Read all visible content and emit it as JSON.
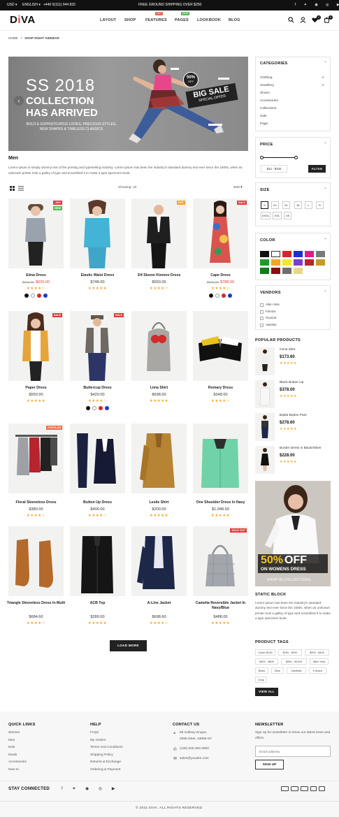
{
  "topbar": {
    "currency": "USD ▾",
    "language": "ENGLISH ▾",
    "phone": "+440 0(111) 044 833",
    "promo": "FREE GROUND SHIPPING OVER $250"
  },
  "header": {
    "logo_main": "D",
    "logo_accent": "i",
    "logo_rest": "VA",
    "nav": [
      "LAYOUT",
      "SHOP",
      "FEATURES",
      "PAGES",
      "LOOKBOOK",
      "BLOG"
    ],
    "badges": {
      "features": "HOT",
      "pages": "NEW"
    },
    "wishlist_count": "0",
    "cart_count": "0"
  },
  "breadcrumb": {
    "home": "HOME",
    "sep": "/",
    "current": "SHOP RIGHT SIDEBAR"
  },
  "banner": {
    "line1": "SS 2018",
    "line2": "COLLECTION",
    "line3": "HAS ARRIVED",
    "sub": "BOLD & SOPHISTICATED LOOKS, PRECIOUS STYLES, NEW SHAPES & TIMELESS CLASSICS",
    "badge_pct": "50%",
    "badge_off": "OFF",
    "sale1": "BIG SALE",
    "sale2": "SPECIAL OFFER"
  },
  "section": {
    "title": "Men",
    "description": "Lorem Ipsum is simply dummy text of the printing and typesetting industry. Lorem Ipsum has been the industry's standard dummy text ever since the 1500s, when an unknown printer took a galley of type and scrambled it to make a type specimen book."
  },
  "toolbar": {
    "showing": "Showing: 22",
    "sort": "Sort ▾"
  },
  "products": [
    {
      "name": "Edna Dress",
      "old": "$500.00",
      "price": "$600.00",
      "sale": true,
      "badges": [
        "-16%",
        "NEW"
      ],
      "badge_colors": [
        "#e03c3c",
        "#5cb85c"
      ],
      "stars": "★★★★☆",
      "swatches": [
        "#111",
        "#fff",
        "#d9232d",
        "#1a3cc2"
      ]
    },
    {
      "name": "Elastic Waist Dress",
      "old": "",
      "price": "$748.00",
      "sale": false,
      "badges": [],
      "badge_colors": [],
      "stars": "★★★★★",
      "swatches": []
    },
    {
      "name": "3/4 Sleeve Kimono Dress",
      "old": "",
      "price": "$550.00",
      "sale": false,
      "badges": [
        "HOT"
      ],
      "badge_colors": [
        "#f5a623"
      ],
      "stars": "★★★★☆",
      "swatches": []
    },
    {
      "name": "Cape Dress",
      "old": "$900.00",
      "price": "$788.00",
      "sale": true,
      "badges": [
        "SALE"
      ],
      "badge_colors": [
        "#e03c3c"
      ],
      "stars": "★★★★☆",
      "swatches": [
        "#111",
        "#fff",
        "#d9232d",
        "#1a3cc2"
      ]
    },
    {
      "name": "Paper Dress",
      "old": "",
      "price": "$550.00",
      "sale": false,
      "badges": [
        "SALE"
      ],
      "badge_colors": [
        "#e03c3c"
      ],
      "stars": "★★★★★",
      "swatches": []
    },
    {
      "name": "Buttercup Dress",
      "old": "",
      "price": "$420.00",
      "sale": false,
      "badges": [
        "SALE"
      ],
      "badge_colors": [
        "#e03c3c"
      ],
      "stars": "★★★★☆",
      "swatches": [
        "#111",
        "#fff",
        "#d9232d",
        "#1a3cc2"
      ]
    },
    {
      "name": "Lima Shirt",
      "old": "",
      "price": "$698.00",
      "sale": false,
      "badges": [],
      "badge_colors": [],
      "stars": "★★★★★",
      "swatches": []
    },
    {
      "name": "Romary Dress",
      "old": "",
      "price": "$348.00",
      "sale": false,
      "badges": [],
      "badge_colors": [],
      "stars": "★★★★☆",
      "swatches": []
    },
    {
      "name": "Floral Sleeveless Dress",
      "old": "",
      "price": "$380.00",
      "sale": false,
      "badges": [
        "POPULAR"
      ],
      "badge_colors": [
        "#f36f48"
      ],
      "stars": "★★★★☆",
      "swatches": []
    },
    {
      "name": "Button Up Dress",
      "old": "",
      "price": "$400.00",
      "sale": false,
      "badges": [],
      "badge_colors": [],
      "stars": "★★★★☆",
      "swatches": []
    },
    {
      "name": "Leslie Shirt",
      "old": "",
      "price": "$200.00",
      "sale": false,
      "badges": [],
      "badge_colors": [],
      "stars": "★★★★★",
      "swatches": []
    },
    {
      "name": "One Shoulder Dress In Navy",
      "old": "",
      "price": "$1,048.60",
      "sale": false,
      "badges": [],
      "badge_colors": [],
      "stars": "★★★★★",
      "swatches": []
    },
    {
      "name": "Triangle Sleeveless Dress In Multi",
      "old": "",
      "price": "$684.60",
      "sale": false,
      "badges": [],
      "badge_colors": [],
      "stars": "★★★★☆",
      "swatches": []
    },
    {
      "name": "ACB Top",
      "old": "",
      "price": "$280.00",
      "sale": false,
      "badges": [],
      "badge_colors": [],
      "stars": "★★★★★",
      "swatches": []
    },
    {
      "name": "A-Line Jacket",
      "old": "",
      "price": "$698.60",
      "sale": false,
      "badges": [],
      "badge_colors": [],
      "stars": "★★★★☆",
      "swatches": []
    },
    {
      "name": "Camelia Reversible Jacket In Navy/Blue",
      "old": "",
      "price": "$488.00",
      "sale": false,
      "badges": [
        "SOLD OUT"
      ],
      "badge_colors": [
        "#e03c3c"
      ],
      "stars": "★★★★★",
      "swatches": []
    }
  ],
  "load_more": "LOAD MORE",
  "sidebar": {
    "categories": {
      "title": "CATEGORIES",
      "items": [
        "Clothing",
        "Jewellery",
        "Shoes",
        "Accessories",
        "Collections",
        "Sale",
        "Page"
      ]
    },
    "price": {
      "title": "PRICE",
      "range": "$12 - $100",
      "button": "FILTER"
    },
    "size": {
      "title": "SIZE",
      "items": [
        "X",
        "XL",
        "XL",
        "M",
        "L",
        "S",
        "XXXL",
        "XXL",
        "XS"
      ]
    },
    "color": {
      "title": "COLOR",
      "colors": [
        "#111111",
        "#ffffff",
        "#d9232d",
        "#1a2fd6",
        "#e5198a",
        "#7a7a7a",
        "#1f9a2a",
        "#f5a623",
        "#f2e92c",
        "#7b3fc6",
        "#b8262a",
        "#c49b2a",
        "#137a1e",
        "#8a1010",
        "#6e6e6e",
        "#e6d886"
      ]
    },
    "vendors": {
      "title": "VENDORS",
      "items": [
        "Allen Vela",
        "Famiza",
        "Oxymat",
        "Vanelas"
      ]
    },
    "popular": {
      "title": "POPULAR PRODUCTS",
      "items": [
        {
          "name": "Cena Skirt",
          "price": "$173.60",
          "stars": "★★★★★"
        },
        {
          "name": "Black Button Up",
          "price": "$378.00",
          "stars": "★★★★★"
        },
        {
          "name": "Balda Button Pant",
          "price": "$278.60",
          "stars": "★★★★★"
        },
        {
          "name": "Border Dress in Black/Silver",
          "price": "$228.00",
          "stars": "★★★★★"
        }
      ]
    },
    "promo": {
      "pct": "50%",
      "off": "OFF",
      "line2": "ON WOMENS DRESS",
      "cta": "SHOP IN COLLECTIONS"
    },
    "static": {
      "title": "STATIC BLOCK",
      "text": "Lorem Ipsum has been the industry's standard dummy text ever since the 1500s, when an unknown printer took a galley of type and scrambled it to make a type specimen book."
    },
    "tags": {
      "title": "PRODUCT TAGS",
      "items": [
        "Under $100",
        "$100 - $200",
        "$200 - $400",
        "$400 - $600",
        "$500 - $1000",
        "Allen Vela",
        "Black",
        "Blue",
        "Cantitate",
        "Famiza",
        "Gray"
      ],
      "button": "VIEW ALL"
    }
  },
  "footer": {
    "quick": {
      "title": "QUICK LINKS",
      "items": [
        "Women",
        "Men",
        "Kids",
        "Deals",
        "Accessories",
        "New In"
      ]
    },
    "help": {
      "title": "HELP",
      "items": [
        "FAQs",
        "My Orders",
        "Terms And Conditions",
        "Shipping Policy",
        "Returns & Exchange",
        "Ordering & Payment"
      ]
    },
    "contact": {
      "title": "CONTACT US",
      "addr1": "55 Gallaxy Enque,",
      "addr2": "2568 steet, 23568 NY",
      "phone": "(440) 000 000 0000",
      "email": "sales@yousite.com"
    },
    "news": {
      "title": "NEWSLETTER",
      "text": "Sign up for newsletter to know our latest news and offers.",
      "placeholder": "Email address",
      "button": "SIGN UP"
    },
    "stay": "STAY CONNECTED",
    "copyright": "© 2021 DIVA. ALL RIGHTS RESERVED."
  }
}
